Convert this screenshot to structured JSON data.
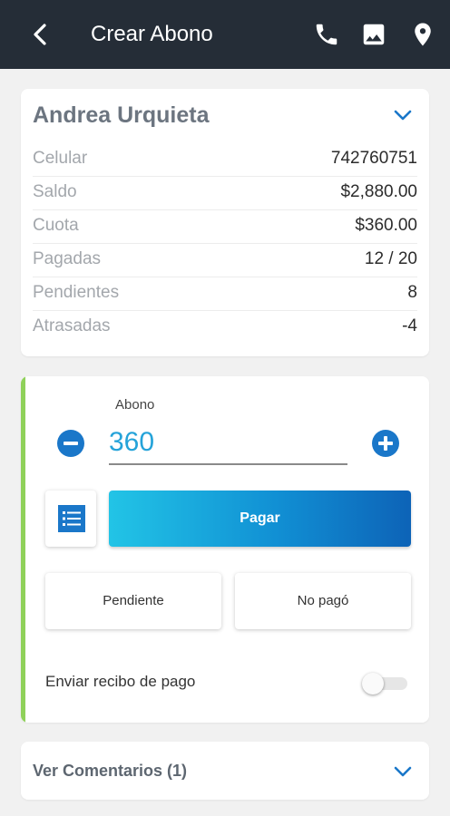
{
  "header": {
    "title": "Crear Abono",
    "back_icon": "arrow-back-icon",
    "actions": [
      "phone-icon",
      "image-icon",
      "location-pin-icon"
    ]
  },
  "client": {
    "name": "Andrea Urquieta",
    "rows": [
      {
        "label": "Celular",
        "value": "742760751"
      },
      {
        "label": "Saldo",
        "value": "$2,880.00"
      },
      {
        "label": "Cuota",
        "value": "$360.00"
      },
      {
        "label": "Pagadas",
        "value": "12 / 20"
      },
      {
        "label": "Pendientes",
        "value": "8"
      },
      {
        "label": "Atrasadas",
        "value": "-4"
      }
    ]
  },
  "payment": {
    "label": "Abono",
    "amount": "360",
    "pay_label": "Pagar",
    "pending_label": "Pendiente",
    "no_pay_label": "No pagó",
    "send_receipt_label": "Enviar recibo de pago",
    "send_receipt_on": false
  },
  "comments": {
    "label": "Ver Comentarios (1)"
  },
  "colors": {
    "appbar": "#252d37",
    "accent": "#8fd15a",
    "primary": "#1a77c9",
    "amount_text": "#25a3d9"
  }
}
